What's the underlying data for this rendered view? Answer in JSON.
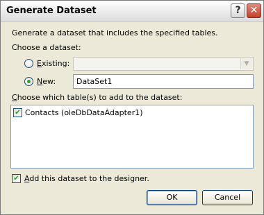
{
  "window": {
    "title": "Generate Dataset",
    "help_glyph": "?",
    "close_glyph": "✕"
  },
  "intro_text": "Generate a dataset that includes the specified tables.",
  "choose_dataset_label": "Choose a dataset:",
  "existing": {
    "label_access": "E",
    "label_rest": "xisting:",
    "selected": false,
    "combo_value": "",
    "enabled": false
  },
  "new": {
    "label_access": "N",
    "label_rest": "ew:",
    "selected": true,
    "value": "DataSet1"
  },
  "tables_label_access": "C",
  "tables_label_rest": "hoose which table(s) to add to the dataset:",
  "tables": [
    {
      "label": "Contacts (oleDbDataAdapter1)",
      "checked": true
    }
  ],
  "add_to_designer": {
    "label_access": "A",
    "label_rest": "dd this dataset to the designer.",
    "checked": true
  },
  "buttons": {
    "ok": "OK",
    "cancel": "Cancel"
  },
  "colors": {
    "dialog_bg": "#ece9d8",
    "radio_dot": "#28a028",
    "check_mark": "#21a121"
  },
  "icons": {
    "check": "✔",
    "combo_arrow": "▼"
  }
}
